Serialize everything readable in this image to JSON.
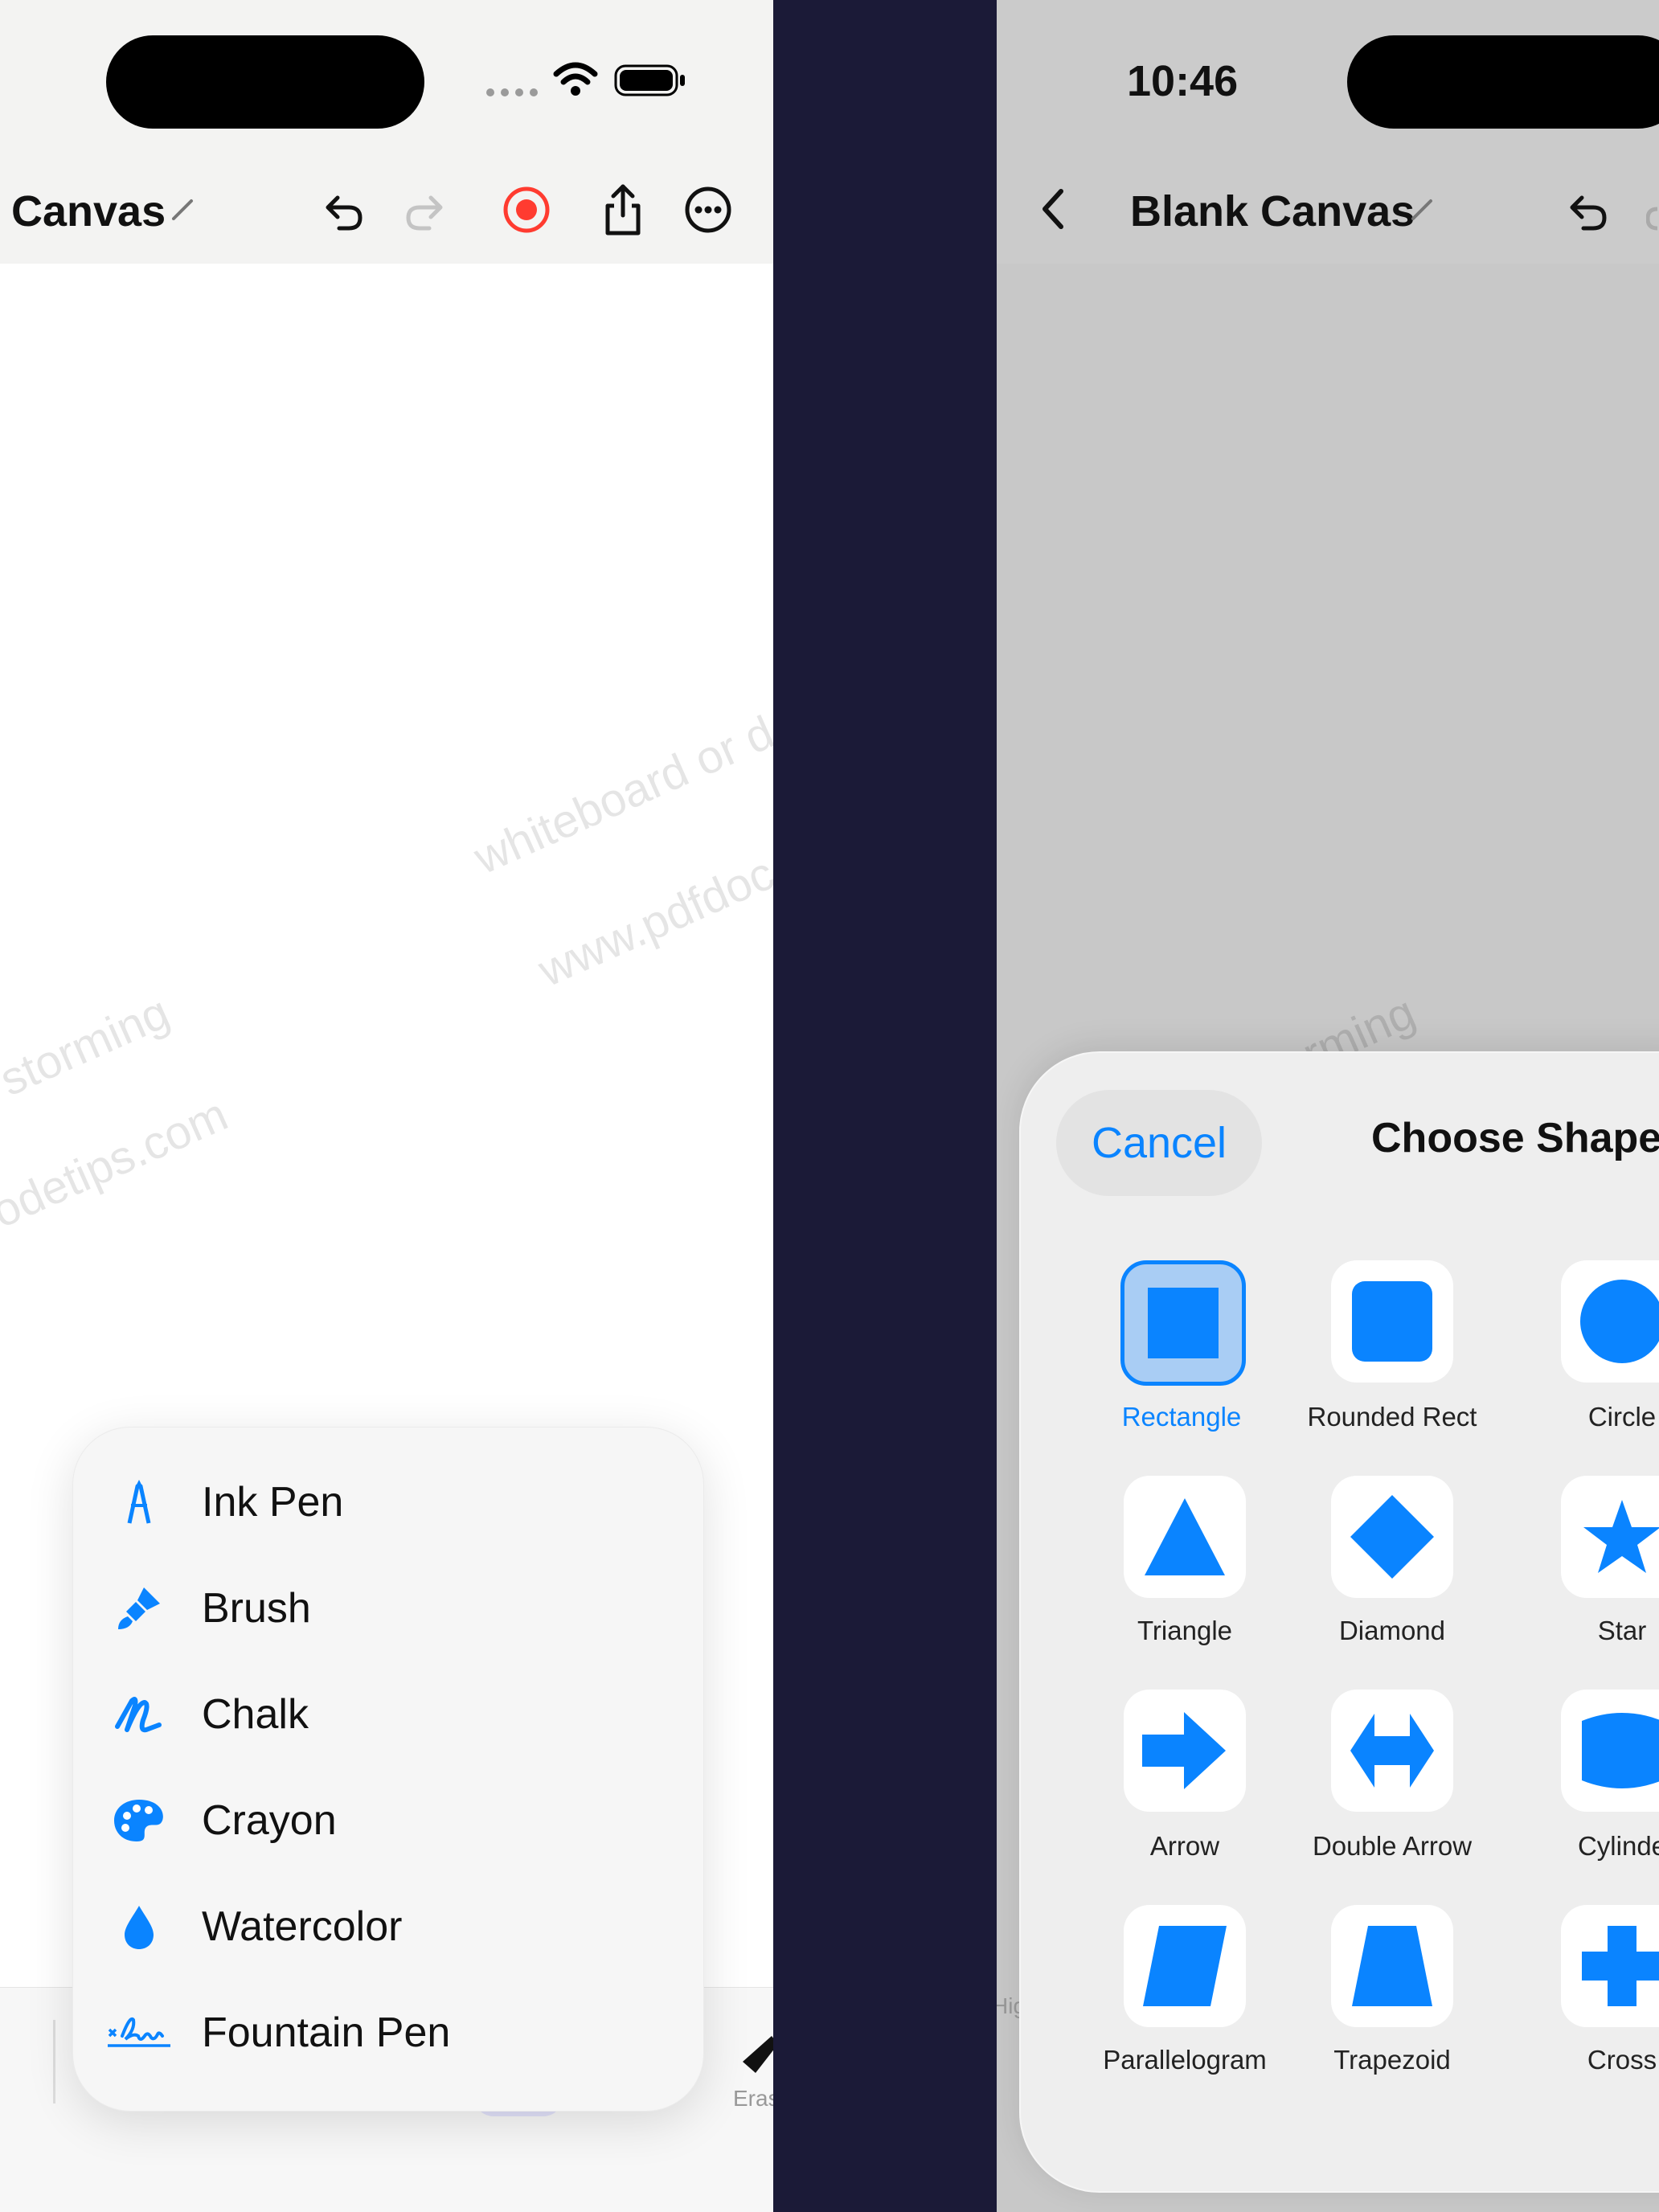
{
  "left": {
    "title": "Canvas",
    "watermark_lines": [
      "whiteboard or d",
      "www.pdfdoc",
      "storming",
      "odetips.com"
    ],
    "tool_menu": {
      "items": [
        {
          "label": "Ink Pen",
          "icon": "ink-pen-icon"
        },
        {
          "label": "Brush",
          "icon": "brush-icon"
        },
        {
          "label": "Chalk",
          "icon": "chalk-icon"
        },
        {
          "label": "Crayon",
          "icon": "palette-icon"
        },
        {
          "label": "Watercolor",
          "icon": "drop-icon"
        },
        {
          "label": "Fountain Pen",
          "icon": "signature-icon"
        }
      ]
    },
    "toolbar": {
      "eraser_label": "Eras"
    }
  },
  "right": {
    "time": "10:46",
    "title": "Blank Canvas",
    "watermark_lines": [
      "storming"
    ],
    "sheet": {
      "cancel": "Cancel",
      "title": "Choose Shape",
      "selected": "Rectangle",
      "shapes": [
        {
          "label": "Rectangle",
          "icon": "rectangle-icon"
        },
        {
          "label": "Rounded Rect",
          "icon": "rounded-rect-icon"
        },
        {
          "label": "Circle",
          "icon": "circle-icon"
        },
        {
          "label": "Triangle",
          "icon": "triangle-icon"
        },
        {
          "label": "Diamond",
          "icon": "diamond-icon"
        },
        {
          "label": "Star",
          "icon": "star-icon"
        },
        {
          "label": "Arrow",
          "icon": "arrow-icon"
        },
        {
          "label": "Double Arrow",
          "icon": "double-arrow-icon"
        },
        {
          "label": "Cylinde",
          "icon": "cylinder-icon"
        },
        {
          "label": "Parallelogram",
          "icon": "parallelogram-icon"
        },
        {
          "label": "Trapezoid",
          "icon": "trapezoid-icon"
        },
        {
          "label": "Cross",
          "icon": "cross-icon"
        }
      ]
    },
    "toolbar_peek": "Hig"
  },
  "colors": {
    "accent": "#0a84ff",
    "record": "#ff3b30",
    "divider_bg": "#1b1a37"
  }
}
